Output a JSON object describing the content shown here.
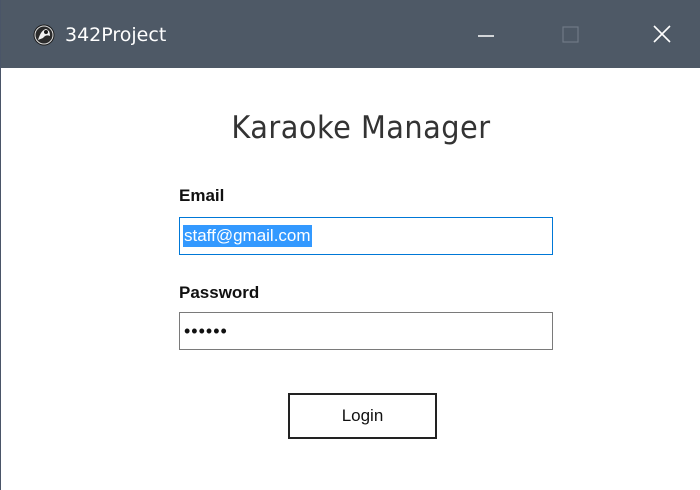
{
  "window": {
    "title": "342Project",
    "titlebar_color": "#4e5966"
  },
  "form": {
    "heading": "Karaoke Manager",
    "email_label": "Email",
    "email_value": "staff@gmail.com",
    "password_label": "Password",
    "password_value": "••••••",
    "login_label": "Login",
    "focus_color": "#0078d7",
    "selection_color": "#3399ff"
  },
  "icons": {
    "app": "app-icon",
    "minimize": "minimize-icon",
    "maximize": "maximize-icon",
    "close": "close-icon"
  }
}
